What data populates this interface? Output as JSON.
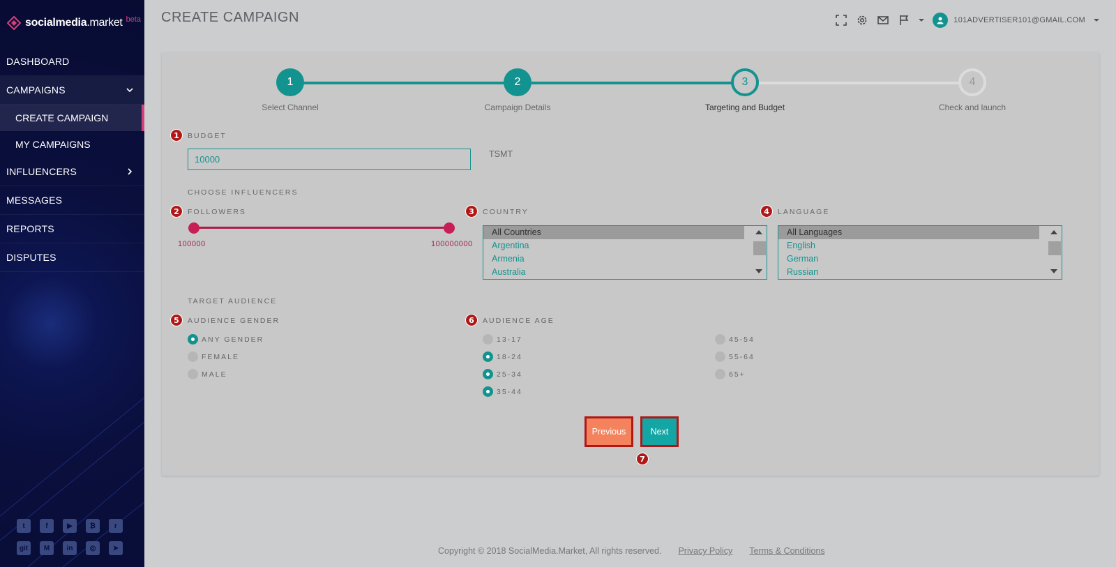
{
  "app": {
    "brand_main": "socialmedia",
    "brand_suffix": ".market",
    "beta": "beta",
    "colors": {
      "accent": "#13938f",
      "sidebar": "#0a0f3d",
      "brand_pink": "#d6407a",
      "danger": "#b01818",
      "previous_button": "#f4835d"
    }
  },
  "sidebar": {
    "items": [
      {
        "label": "DASHBOARD"
      },
      {
        "label": "CAMPAIGNS",
        "icon": "chevron-down-icon"
      },
      {
        "label": "INFLUENCERS",
        "icon": "chevron-right-icon"
      },
      {
        "label": "MESSAGES"
      },
      {
        "label": "REPORTS"
      },
      {
        "label": "DISPUTES"
      }
    ],
    "subitems": [
      {
        "label": "CREATE CAMPAIGN",
        "active": true
      },
      {
        "label": "MY CAMPAIGNS"
      }
    ],
    "social": [
      {
        "name": "twitter-icon",
        "glyph": "t"
      },
      {
        "name": "facebook-icon",
        "glyph": "f"
      },
      {
        "name": "youtube-icon",
        "glyph": "▶"
      },
      {
        "name": "bitcoin-icon",
        "glyph": "₿"
      },
      {
        "name": "reddit-icon",
        "glyph": "r"
      },
      {
        "name": "git-icon",
        "glyph": "git"
      },
      {
        "name": "medium-icon",
        "glyph": "M"
      },
      {
        "name": "linkedin-icon",
        "glyph": "in"
      },
      {
        "name": "instagram-icon",
        "glyph": "◎"
      },
      {
        "name": "telegram-icon",
        "glyph": "➤"
      }
    ]
  },
  "header": {
    "title": "CREATE CAMPAIGN",
    "user_email": "101ADVERTISER101@GMAIL.COM",
    "icons": [
      "fullscreen-icon",
      "gear-icon",
      "mail-icon",
      "flag-icon"
    ]
  },
  "stepper": {
    "steps": [
      {
        "number": "1",
        "label": "Select Channel",
        "state": "done"
      },
      {
        "number": "2",
        "label": "Campaign Details",
        "state": "done"
      },
      {
        "number": "3",
        "label": "Targeting and Budget",
        "state": "current"
      },
      {
        "number": "4",
        "label": "Check and launch",
        "state": "todo"
      }
    ]
  },
  "budget": {
    "badge": "1",
    "label": "BUDGET",
    "value": "10000",
    "unit": "TSMT"
  },
  "influencers": {
    "label": "CHOOSE INFLUENCERS",
    "followers": {
      "badge": "2",
      "label": "FOLLOWERS",
      "min": "100000",
      "max": "100000000",
      "min_fraction": 0,
      "max_fraction": 1
    },
    "country": {
      "badge": "3",
      "label": "COUNTRY",
      "options": [
        "All Countries",
        "Argentina",
        "Armenia",
        "Australia"
      ],
      "selected": "All Countries"
    },
    "language": {
      "badge": "4",
      "label": "LANGUAGE",
      "options": [
        "All Languages",
        "English",
        "German",
        "Russian"
      ],
      "selected": "All Languages"
    }
  },
  "audience": {
    "label": "TARGET AUDIENCE",
    "gender": {
      "badge": "5",
      "label": "AUDIENCE GENDER",
      "options": [
        {
          "label": "ANY GENDER",
          "checked": true
        },
        {
          "label": "FEMALE",
          "checked": false
        },
        {
          "label": "MALE",
          "checked": false
        }
      ]
    },
    "age": {
      "badge": "6",
      "label": "AUDIENCE AGE",
      "options": [
        {
          "label": "13-17",
          "checked": false
        },
        {
          "label": "18-24",
          "checked": true
        },
        {
          "label": "25-34",
          "checked": true
        },
        {
          "label": "35-44",
          "checked": true
        },
        {
          "label": "45-54",
          "checked": false
        },
        {
          "label": "55-64",
          "checked": false
        },
        {
          "label": "65+",
          "checked": false
        }
      ]
    }
  },
  "actions": {
    "badge": "7",
    "previous": "Previous",
    "next": "Next"
  },
  "footer": {
    "copyright": "Copyright © 2018 SocialMedia.Market, All rights reserved.",
    "privacy": "Privacy Policy",
    "terms": "Terms & Conditions"
  }
}
